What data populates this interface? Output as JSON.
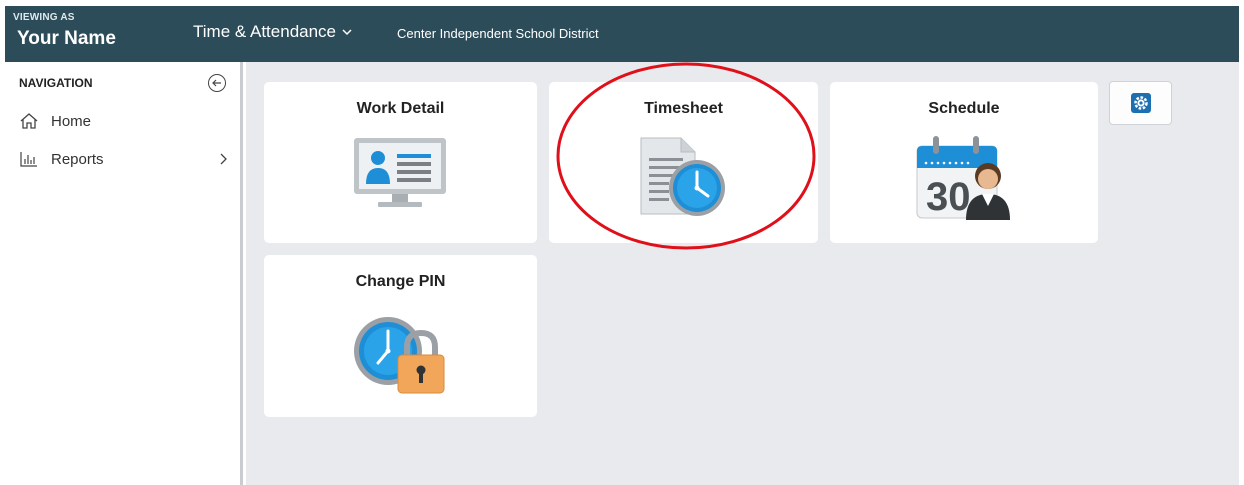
{
  "header": {
    "viewing_label": "VIEWING AS",
    "user_name": "Your Name",
    "app_name": "Time & Attendance",
    "district": "Center Independent School District"
  },
  "sidebar": {
    "title": "NAVIGATION",
    "items": [
      {
        "label": "Home",
        "icon": "home-icon"
      },
      {
        "label": "Reports",
        "icon": "bar-chart-icon"
      }
    ]
  },
  "tiles": [
    {
      "title": "Work Detail",
      "icon": "id-card-monitor-icon"
    },
    {
      "title": "Timesheet",
      "icon": "timesheet-clock-icon"
    },
    {
      "title": "Schedule",
      "icon": "calendar-person-icon"
    },
    {
      "title": "Change PIN",
      "icon": "clock-lock-icon"
    }
  ],
  "calendar_day": "30",
  "colors": {
    "header_bg": "#2d4c59",
    "main_bg": "#e8eaed",
    "accent_blue": "#1e8fd6",
    "annotation_red": "#e0101a"
  }
}
